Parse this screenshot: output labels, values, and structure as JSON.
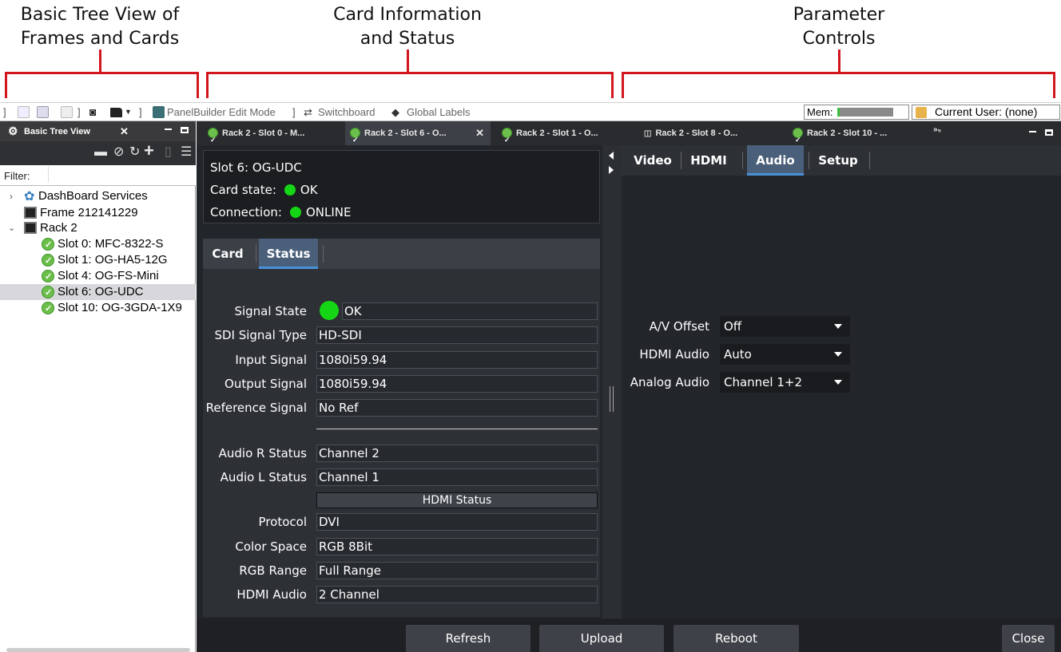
{
  "callouts": {
    "tree": {
      "line1": "Basic Tree View of",
      "line2": "Frames and Cards"
    },
    "card": {
      "line1": "Card Information",
      "line2": "and Status"
    },
    "params": {
      "line1": "Parameter",
      "line2": "Controls"
    }
  },
  "toolbar": {
    "panelbuilder": "PanelBuilder Edit Mode",
    "switchboard": "Switchboard",
    "global_labels": "Global Labels",
    "mem_label": "Mem:",
    "current_user": "Current User: (none)"
  },
  "left_panel": {
    "title": "Basic Tree View",
    "filter_label": "Filter:",
    "tree": [
      {
        "label": "DashBoard Services",
        "icon": "services-icon"
      },
      {
        "label": "Frame 212141229",
        "icon": "frame-icon"
      },
      {
        "label": "Rack 2",
        "icon": "frame-icon"
      },
      {
        "label": "Slot 0: MFC-8322-S",
        "icon": "ok-status-icon"
      },
      {
        "label": "Slot 1: OG-HA5-12G",
        "icon": "ok-status-icon"
      },
      {
        "label": "Slot 4: OG-FS-Mini",
        "icon": "ok-status-icon"
      },
      {
        "label": "Slot 6: OG-UDC",
        "icon": "ok-status-icon",
        "selected": true
      },
      {
        "label": "Slot 10: OG-3GDA-1X9",
        "icon": "ok-status-icon"
      }
    ]
  },
  "tabs": [
    {
      "label": "Rack 2 - Slot 0 - M..."
    },
    {
      "label": "Rack 2 - Slot 6 - O...",
      "active": true
    },
    {
      "label": "Rack 2 - Slot 1 - O..."
    },
    {
      "label": "Rack 2 - Slot 8 - O..."
    },
    {
      "label": "Rack 2 - Slot 10 - ..."
    }
  ],
  "tab_overflow": "»₅",
  "card_info": {
    "slot": "Slot 6: OG-UDC",
    "state_label": "Card state:",
    "state_value": "OK",
    "connection_label": "Connection:",
    "connection_value": "ONLINE"
  },
  "card_tabs": {
    "card": "Card",
    "status": "Status"
  },
  "status": {
    "signal_state": {
      "label": "Signal State",
      "value": "OK"
    },
    "sdi_type": {
      "label": "SDI Signal Type",
      "value": "HD-SDI"
    },
    "input_signal": {
      "label": "Input Signal",
      "value": "1080i59.94"
    },
    "output_signal": {
      "label": "Output Signal",
      "value": "1080i59.94"
    },
    "reference_signal": {
      "label": "Reference Signal",
      "value": "No Ref"
    },
    "audio_r": {
      "label": "Audio R Status",
      "value": "Channel 2"
    },
    "audio_l": {
      "label": "Audio L Status",
      "value": "Channel 1"
    },
    "hdmi_header": "HDMI Status",
    "protocol": {
      "label": "Protocol",
      "value": "DVI"
    },
    "color_space": {
      "label": "Color Space",
      "value": "RGB 8Bit"
    },
    "rgb_range": {
      "label": "RGB Range",
      "value": "Full Range"
    },
    "hdmi_audio": {
      "label": "HDMI Audio",
      "value": "2 Channel"
    }
  },
  "buttons": {
    "refresh": "Refresh",
    "upload": "Upload",
    "reboot": "Reboot",
    "close": "Close"
  },
  "param_tabs": {
    "video": "Video",
    "hdmi": "HDMI",
    "audio": "Audio",
    "setup": "Setup"
  },
  "params": {
    "av_offset": {
      "label": "A/V Offset",
      "value": "Off"
    },
    "hdmi_audio": {
      "label": "HDMI Audio",
      "value": "Auto"
    },
    "analog_audio": {
      "label": "Analog Audio",
      "value": "Channel 1+2"
    }
  },
  "colors": {
    "accent_red": "#d2161e",
    "ok_green": "#15d615",
    "active_tab": "#4a5f7a"
  }
}
